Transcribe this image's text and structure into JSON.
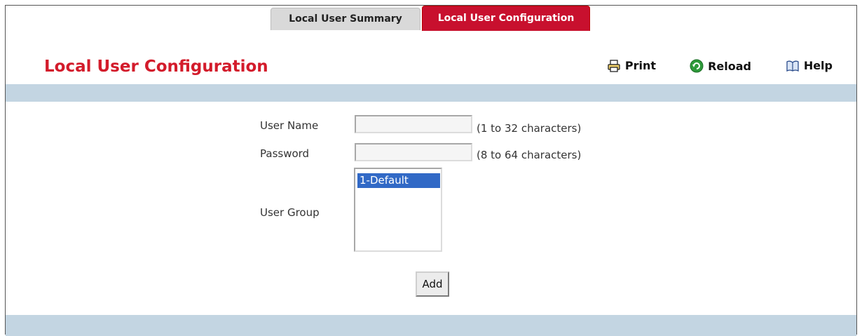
{
  "tabs": [
    {
      "label": "Local User Summary",
      "active": false
    },
    {
      "label": "Local User Configuration",
      "active": true
    }
  ],
  "page": {
    "title": "Local User Configuration"
  },
  "actions": {
    "print": "Print",
    "reload": "Reload",
    "help": "Help"
  },
  "form": {
    "user_name": {
      "label": "User Name",
      "value": "",
      "hint": "(1 to 32 characters)"
    },
    "password": {
      "label": "Password",
      "value": "",
      "hint": "(8 to 64 characters)"
    },
    "user_group": {
      "label": "User Group",
      "options": [
        "1-Default"
      ],
      "selected": "1-Default"
    },
    "add_button": "Add"
  },
  "colors": {
    "tab_active": "#c8102e",
    "title": "#d31b2b",
    "band": "#c3d5e2",
    "selection": "#3169c6"
  }
}
